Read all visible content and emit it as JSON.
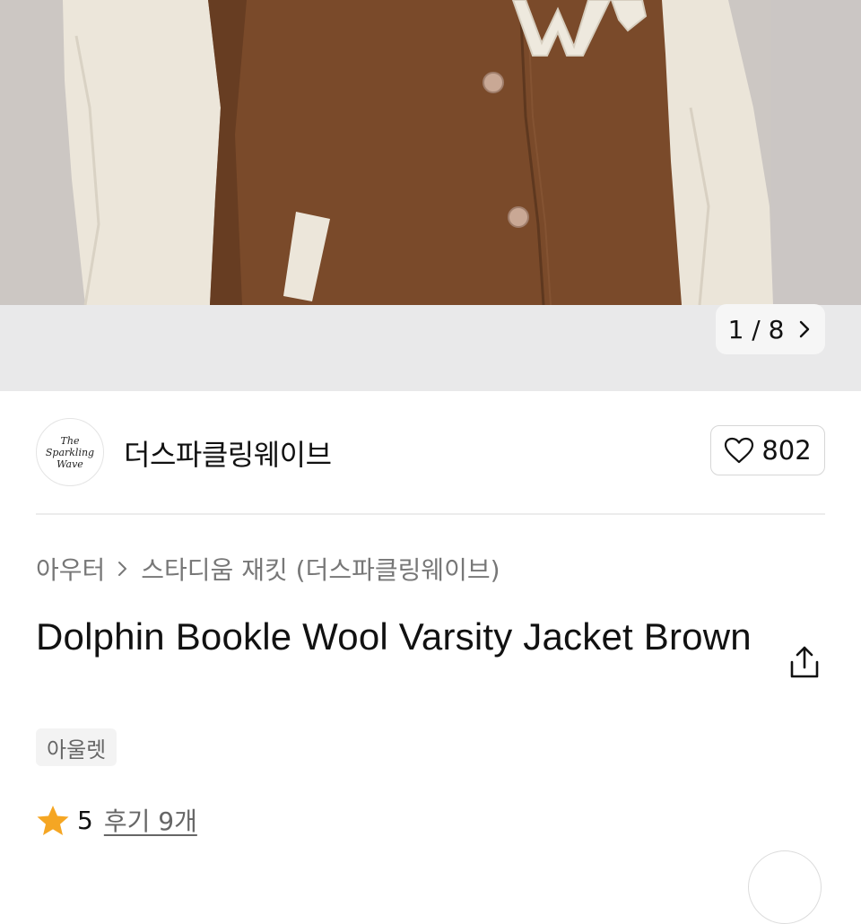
{
  "gallery": {
    "page_current": "1",
    "page_total": "8",
    "page_indicator": "1 / 8",
    "chevron_icon": "chevron-right-icon"
  },
  "brand": {
    "name": "더스파클링웨이브",
    "logo_text": [
      "The",
      "Sparkling",
      "Wave"
    ],
    "like_count": "802",
    "like_icon": "heart-outline-icon"
  },
  "breadcrumb": {
    "category": "아우터",
    "subcategory": "스타디움 재킷 (더스파클링웨이브)"
  },
  "product": {
    "title": "Dolphin Bookle Wool Varsity Jacket Brown",
    "tag": "아울렛",
    "rating": "5",
    "reviews": "후기 9개"
  },
  "colors": {
    "jacket_body": "#7a4a2a",
    "sleeve": "#ece6da",
    "star": "#f5a623"
  }
}
